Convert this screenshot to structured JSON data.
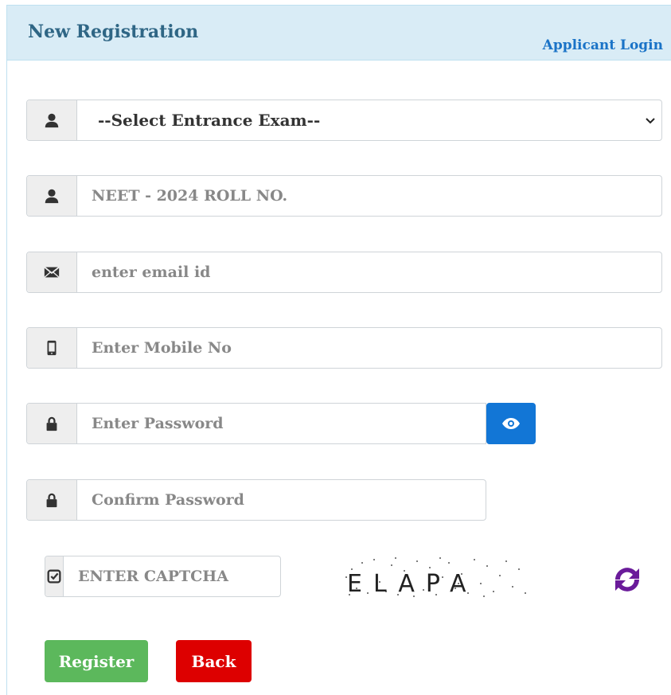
{
  "header": {
    "title": "New Registration",
    "login_link": "Applicant Login"
  },
  "form": {
    "exam_select": {
      "selected": "--Select Entrance Exam--",
      "icon": "user-icon"
    },
    "roll_no": {
      "placeholder": "NEET - 2024 ROLL NO.",
      "value": "",
      "icon": "user-icon"
    },
    "email": {
      "placeholder": "enter email id",
      "value": "",
      "icon": "envelope-icon"
    },
    "mobile": {
      "placeholder": "Enter Mobile No",
      "value": "",
      "icon": "mobile-icon"
    },
    "password": {
      "placeholder": "Enter Password",
      "value": "",
      "icon": "lock-icon"
    },
    "confirm_password": {
      "placeholder": "Confirm Password",
      "value": "",
      "icon": "lock-icon"
    },
    "captcha": {
      "placeholder": "ENTER CAPTCHA",
      "value": "",
      "image_text": "ELAPA",
      "icon": "check-square-icon"
    }
  },
  "buttons": {
    "register": "Register",
    "back": "Back"
  },
  "colors": {
    "header_bg": "#d9ecf6",
    "title": "#2f6685",
    "link": "#1a73c7",
    "eye_button": "#1276d6",
    "register": "#5cb85c",
    "back": "#dd0000",
    "refresh": "#6a1b9a"
  }
}
